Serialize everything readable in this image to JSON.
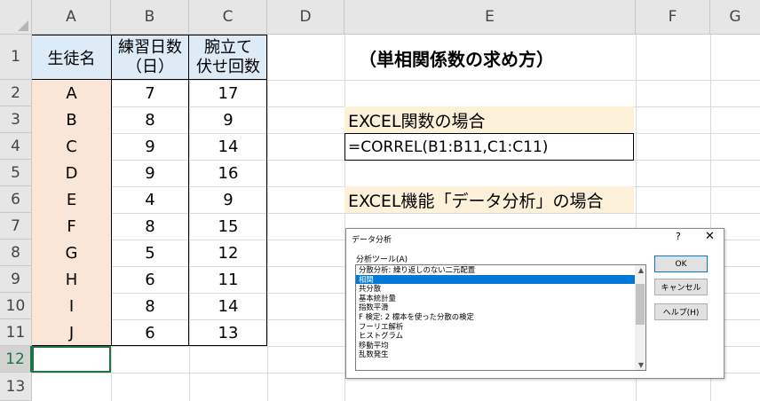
{
  "columns": [
    "A",
    "B",
    "C",
    "D",
    "E",
    "F",
    "G"
  ],
  "rows": [
    "1",
    "2",
    "3",
    "4",
    "5",
    "6",
    "7",
    "8",
    "9",
    "10",
    "11",
    "12",
    "13"
  ],
  "header": {
    "student": "生徒名",
    "practice_line1": "練習日数",
    "practice_line2": "（日）",
    "pushup_line1": "腕立て",
    "pushup_line2": "伏せ回数"
  },
  "table": [
    {
      "name": "A",
      "days": "7",
      "count": "17"
    },
    {
      "name": "B",
      "days": "8",
      "count": "9"
    },
    {
      "name": "C",
      "days": "9",
      "count": "14"
    },
    {
      "name": "D",
      "days": "9",
      "count": "16"
    },
    {
      "name": "E",
      "days": "4",
      "count": "9"
    },
    {
      "name": "F",
      "days": "8",
      "count": "15"
    },
    {
      "name": "G",
      "days": "5",
      "count": "12"
    },
    {
      "name": "H",
      "days": "6",
      "count": "11"
    },
    {
      "name": "I",
      "days": "8",
      "count": "14"
    },
    {
      "name": "J",
      "days": "6",
      "count": "13"
    }
  ],
  "title": "（単相関係数の求め方）",
  "excel_func_label": "EXCEL関数の場合",
  "formula": "=CORREL(B1:B11,C1:C11)",
  "excel_feature_label": "EXCEL機能「データ分析」の場合",
  "dialog": {
    "title": "データ分析",
    "help": "?",
    "close": "✕",
    "list_label": "分析ツール(A)",
    "items": [
      "分散分析: 繰り返しのない二元配置",
      "相関",
      "共分散",
      "基本統計量",
      "指数平滑",
      "F 検定: 2 標本を使った分散の検定",
      "フーリエ解析",
      "ヒストグラム",
      "移動平均",
      "乱数発生"
    ],
    "selected_index": 1,
    "ok": "OK",
    "cancel": "キャンセル",
    "helpbtn": "ヘルプ(H)"
  },
  "colors": {
    "name_fill": "#fbe5d6",
    "header_fill": "#ddebf7",
    "band_fill": "#fdf2d9",
    "selection": "#217346",
    "list_highlight": "#0078d7"
  }
}
